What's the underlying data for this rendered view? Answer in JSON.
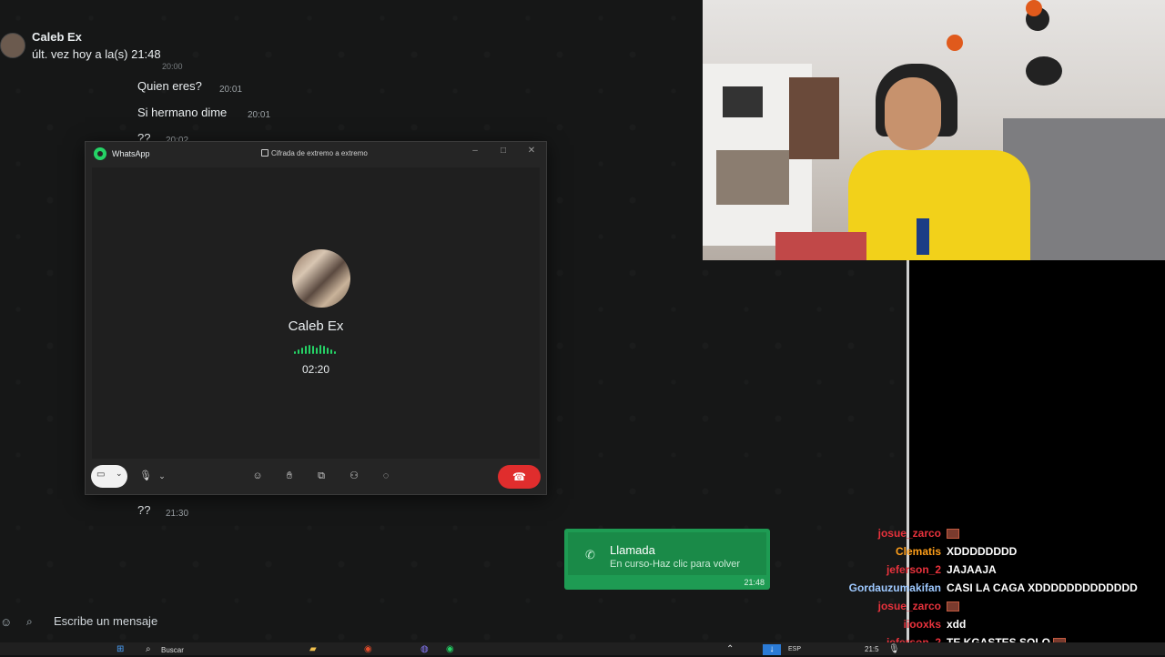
{
  "chat": {
    "contact_name": "Caleb Ex",
    "last_seen": "últ. vez hoy a la(s) 21:48",
    "messages": [
      {
        "text": "Quien eres?",
        "time": "20:01"
      },
      {
        "text": "Si hermano dime",
        "time": "20:01"
      },
      {
        "text": "??",
        "time": "20:02"
      },
      {
        "text": "??",
        "time": "21:30"
      }
    ],
    "cut_time_top": "20:00",
    "composer_placeholder": "Escribe un mensaje"
  },
  "call_window": {
    "app_name": "WhatsApp",
    "encryption": "Cifrada de extremo a extremo",
    "callee": "Caleb Ex",
    "timer": "02:20",
    "accent": "#25d366",
    "end_color": "#e02d2d"
  },
  "notification": {
    "title": "Llamada",
    "subtitle": "En curso-Haz clic para volver",
    "time": "21:48",
    "color": "#1e9b53"
  },
  "stream_chat": [
    {
      "user": "josue_zarco",
      "color": "#e8323c",
      "message": "",
      "emote": true
    },
    {
      "user": "Clematis",
      "color": "#ff9f1a",
      "message": "XDDDDDDDD",
      "emote": false
    },
    {
      "user": "jeferson_2",
      "color": "#e8323c",
      "message": "JAJAAJA",
      "emote": false
    },
    {
      "user": "Gordauzumakifan",
      "color": "#9ec9ff",
      "message": "CASI LA CAGA XDDDDDDDDDDDDD",
      "emote": false
    },
    {
      "user": "josue_zarco",
      "color": "#e8323c",
      "message": "",
      "emote": true
    },
    {
      "user": "iiooxks",
      "color": "#e8323c",
      "message": "xdd",
      "emote": false
    },
    {
      "user": "jeferson_2",
      "color": "#e8323c",
      "message": "TE KGASTES SOLO",
      "emote": true
    }
  ],
  "taskbar": {
    "search_label": "Buscar",
    "language": "ESP",
    "clock": "21:5"
  }
}
